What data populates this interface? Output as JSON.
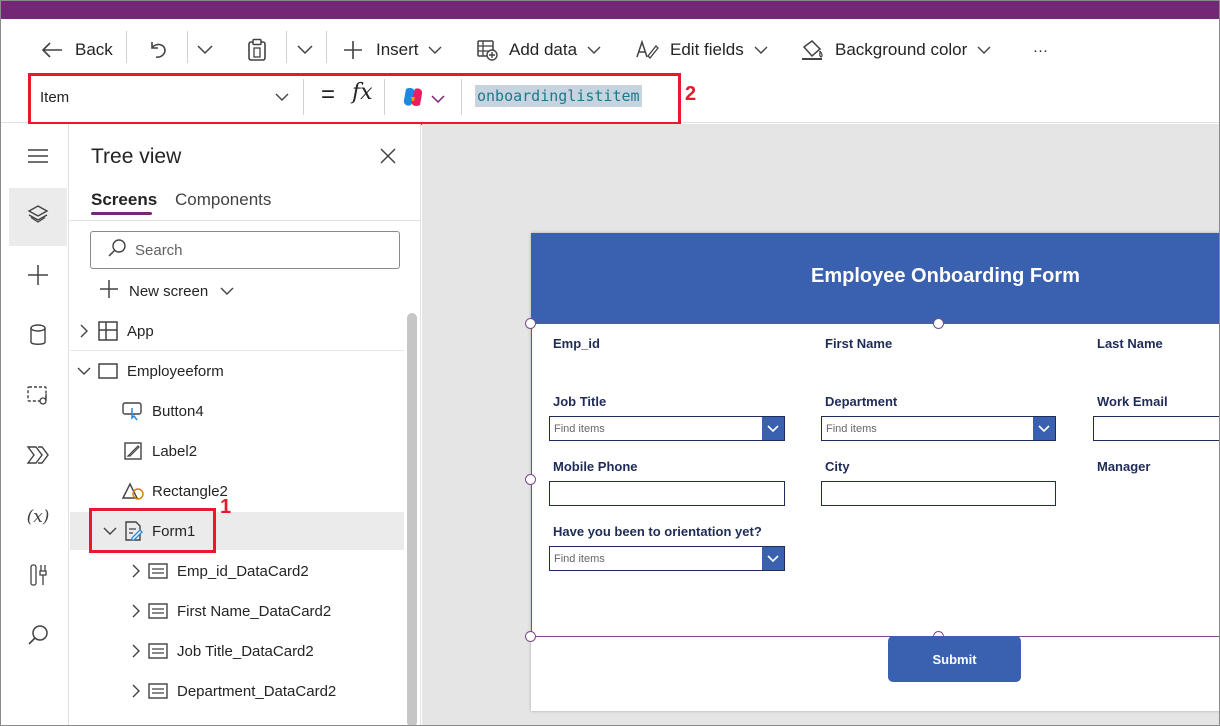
{
  "command_bar": {
    "back": "Back",
    "insert": "Insert",
    "add_data": "Add data",
    "edit_fields": "Edit fields",
    "background_color": "Background color",
    "more": "···"
  },
  "formula_bar": {
    "property": "Item",
    "equals": "=",
    "fx": "fx",
    "formula": "onboardinglistitem"
  },
  "callouts": {
    "one": "1",
    "two": "2"
  },
  "tree_view": {
    "title": "Tree view",
    "tabs": {
      "screens": "Screens",
      "components": "Components"
    },
    "search_placeholder": "Search",
    "new_screen": "New screen",
    "items": {
      "app": "App",
      "employeeform": "Employeeform",
      "button4": "Button4",
      "label2": "Label2",
      "rectangle2": "Rectangle2",
      "form1": "Form1",
      "emp_id_card": "Emp_id_DataCard2",
      "first_name_card": "First Name_DataCard2",
      "job_title_card": "Job Title_DataCard2",
      "department_card": "Department_DataCard2"
    }
  },
  "form": {
    "title": "Employee Onboarding Form",
    "labels": {
      "emp_id": "Emp_id",
      "first_name": "First Name",
      "last_name": "Last Name",
      "job_title": "Job Title",
      "department": "Department",
      "work_email": "Work Email",
      "mobile_phone": "Mobile Phone",
      "city": "City",
      "manager": "Manager",
      "orientation": "Have you been to orientation yet?"
    },
    "combo_placeholder": "Find items",
    "submit": "Submit"
  },
  "colors": {
    "brand_purple": "#742774",
    "header_blue": "#3961b0",
    "label_navy": "#1f2b58",
    "callout_red": "#e8192c"
  }
}
